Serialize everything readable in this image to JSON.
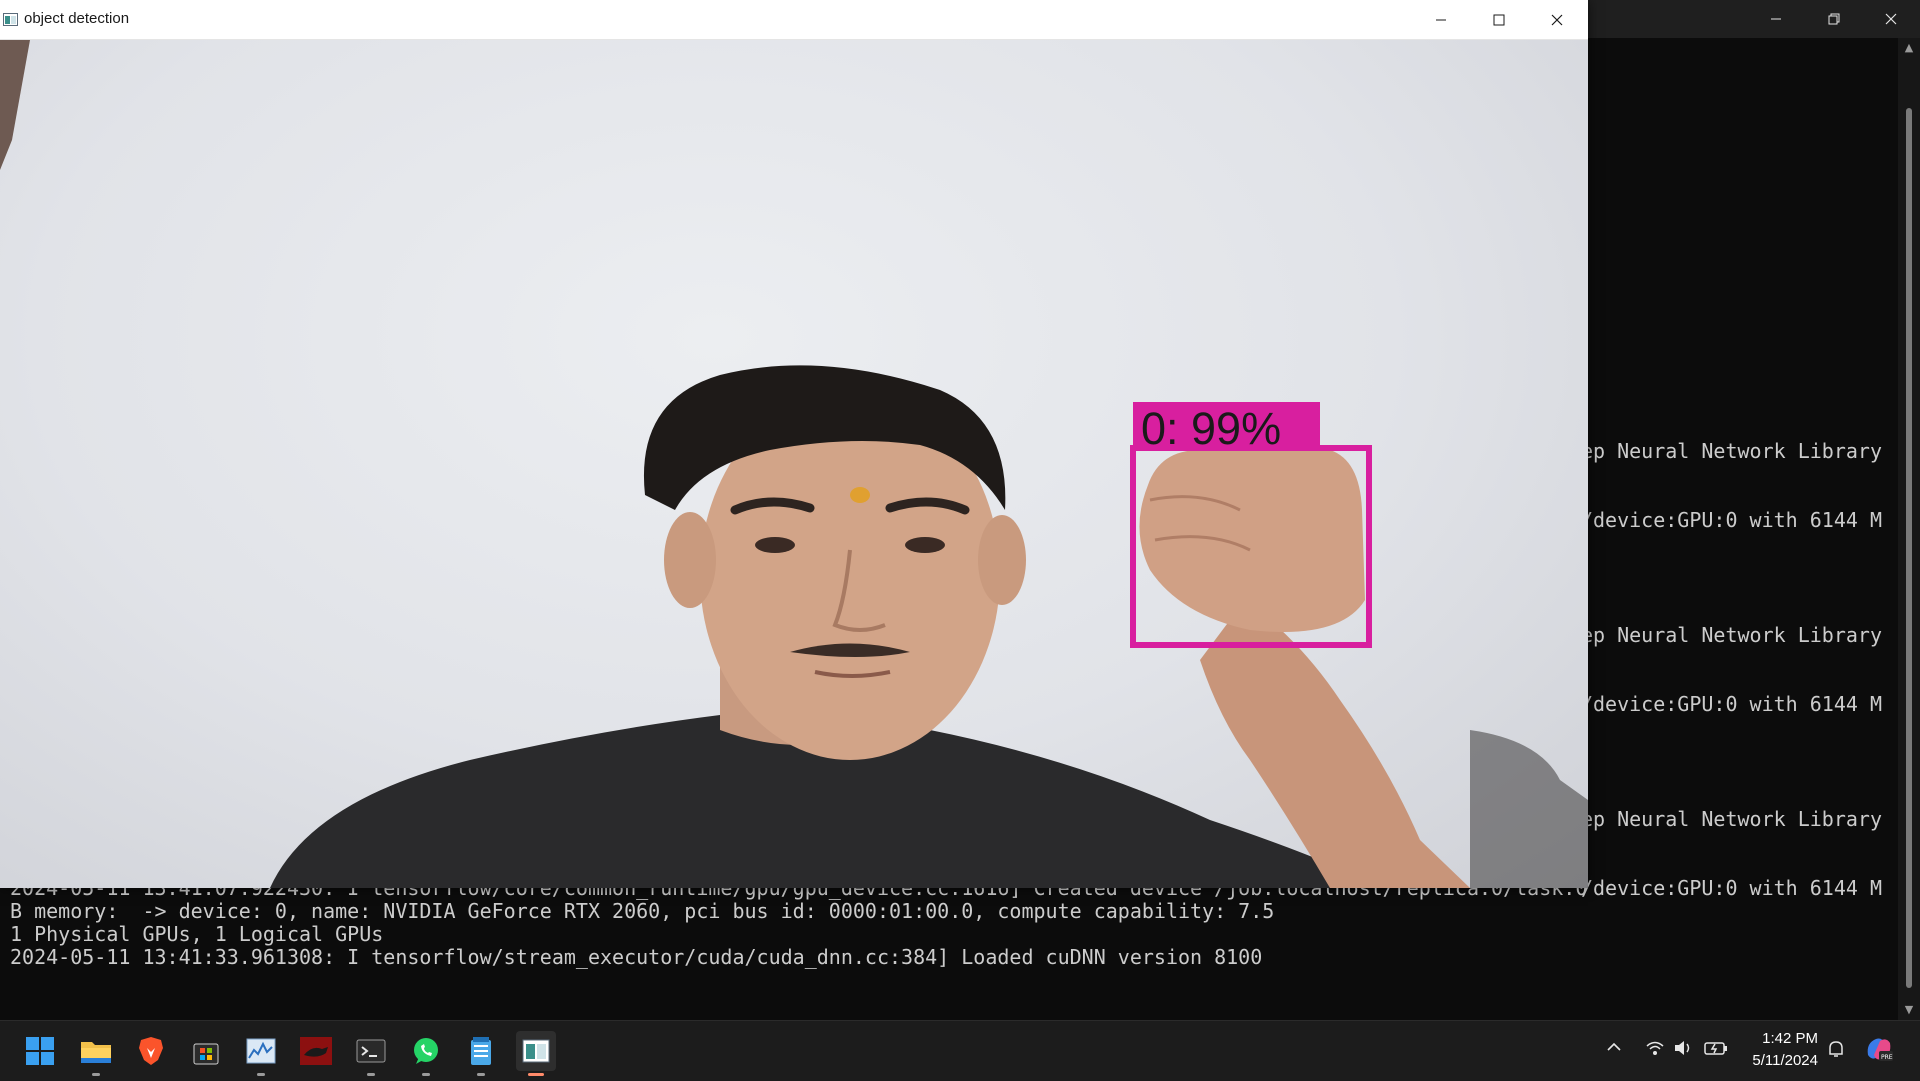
{
  "terminal": {
    "right_lines": [
      "ep Neural Network Library",
      "/device:GPU:0 with 6144 M",
      "ep Neural Network Library",
      "/device:GPU:0 with 6144 M",
      "ep Neural Network Library",
      "/device:GPU:0 with 6144 M"
    ],
    "clipped_line": "2024-05-11 13:41:07.922430: I tensorflow/core/common_runtime/gpu/gpu_device.cc:1616] Created device /job:localhost/replica:0/task:0",
    "bottom_lines": [
      "B memory:  -> device: 0, name: NVIDIA GeForce RTX 2060, pci bus id: 0000:01:00.0, compute capability: 7.5",
      "1 Physical GPUs, 1 Logical GPUs",
      "2024-05-11 13:41:33.961308: I tensorflow/stream_executor/cuda/cuda_dnn.cc:384] Loaded cuDNN version 8100"
    ]
  },
  "window": {
    "title": "object detection"
  },
  "detection": {
    "label": "0: 99%",
    "color": "#d81f9f"
  },
  "taskbar": {
    "apps": [
      "windows-start",
      "file-explorer",
      "brave-browser",
      "microsoft-store",
      "task-manager",
      "game-app",
      "terminal",
      "whatsapp",
      "notepad",
      "object-detection"
    ],
    "clock": {
      "time": "1:42 PM",
      "date": "5/11/2024"
    }
  }
}
